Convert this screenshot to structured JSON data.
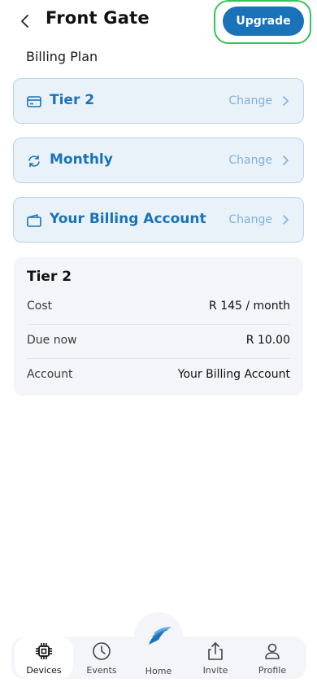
{
  "header": {
    "title": "Front Gate",
    "upgrade_label": "Upgrade"
  },
  "section_label": "Billing Plan",
  "options": [
    {
      "label": "Tier 2",
      "action": "Change",
      "icon": "credit-card-icon"
    },
    {
      "label": "Monthly",
      "action": "Change",
      "icon": "refresh-icon"
    },
    {
      "label": "Your Billing Account",
      "action": "Change",
      "icon": "wallet-icon"
    }
  ],
  "summary": {
    "title": "Tier 2",
    "rows": [
      {
        "key": "Cost",
        "value": "R 145 / month"
      },
      {
        "key": "Due now",
        "value": "R 10.00"
      },
      {
        "key": "Account",
        "value": "Your Billing Account"
      }
    ]
  },
  "tabs": [
    {
      "label": "Devices",
      "icon": "chip-icon",
      "active": true
    },
    {
      "label": "Events",
      "icon": "clock-icon",
      "active": false
    },
    {
      "label": "Home",
      "icon": "logo-icon",
      "active": false
    },
    {
      "label": "Invite",
      "icon": "share-icon",
      "active": false
    },
    {
      "label": "Profile",
      "icon": "person-icon",
      "active": false
    }
  ],
  "colors": {
    "accent": "#1a73b8",
    "card_bg": "#eaf2f9",
    "card_border": "#b9d3ea",
    "focus_ring": "#35c45c"
  }
}
